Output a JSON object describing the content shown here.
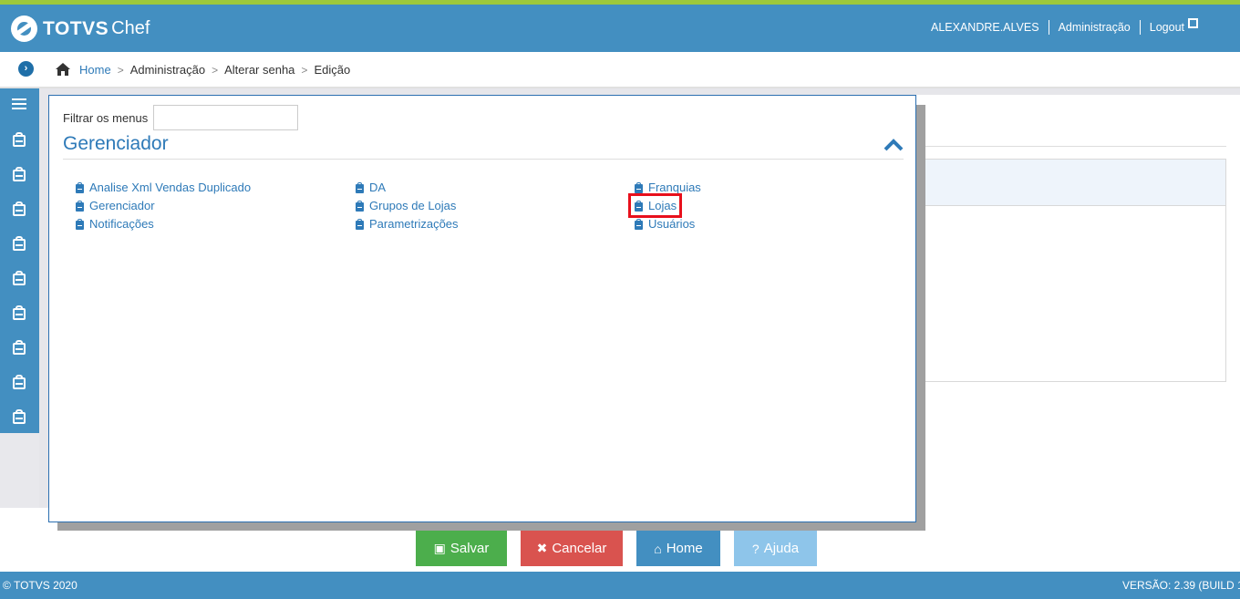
{
  "brand": {
    "name": "TOTVS",
    "product": "Chef"
  },
  "topbar": {
    "user": "ALEXANDRE.ALVES",
    "admin_link": "Administração",
    "logout_label": "Logout"
  },
  "breadcrumb": {
    "home": "Home",
    "items": [
      "Administração",
      "Alterar senha",
      "Edição"
    ]
  },
  "modal": {
    "filter_label": "Filtrar os menus",
    "filter_value": "",
    "section_title": "Gerenciador",
    "columns": [
      [
        "Analise Xml Vendas Duplicado",
        "Gerenciador",
        "Notificações"
      ],
      [
        "DA",
        "Grupos de Lojas",
        "Parametrizações"
      ],
      [
        "Franquias",
        "Lojas",
        "Usuários"
      ]
    ],
    "highlighted_item": "Lojas"
  },
  "actions": {
    "save": "Salvar",
    "cancel": "Cancelar",
    "home": "Home",
    "help": "Ajuda"
  },
  "footer": {
    "copyright": "© TOTVS 2020",
    "version": "VERSÃO: 2.39 (BUILD 1"
  },
  "colors": {
    "primary": "#438fc1",
    "accent": "#9dc83c",
    "link": "#2e7ab8",
    "success": "#4cae4c",
    "danger": "#d9534f",
    "highlight": "#e8101c"
  }
}
